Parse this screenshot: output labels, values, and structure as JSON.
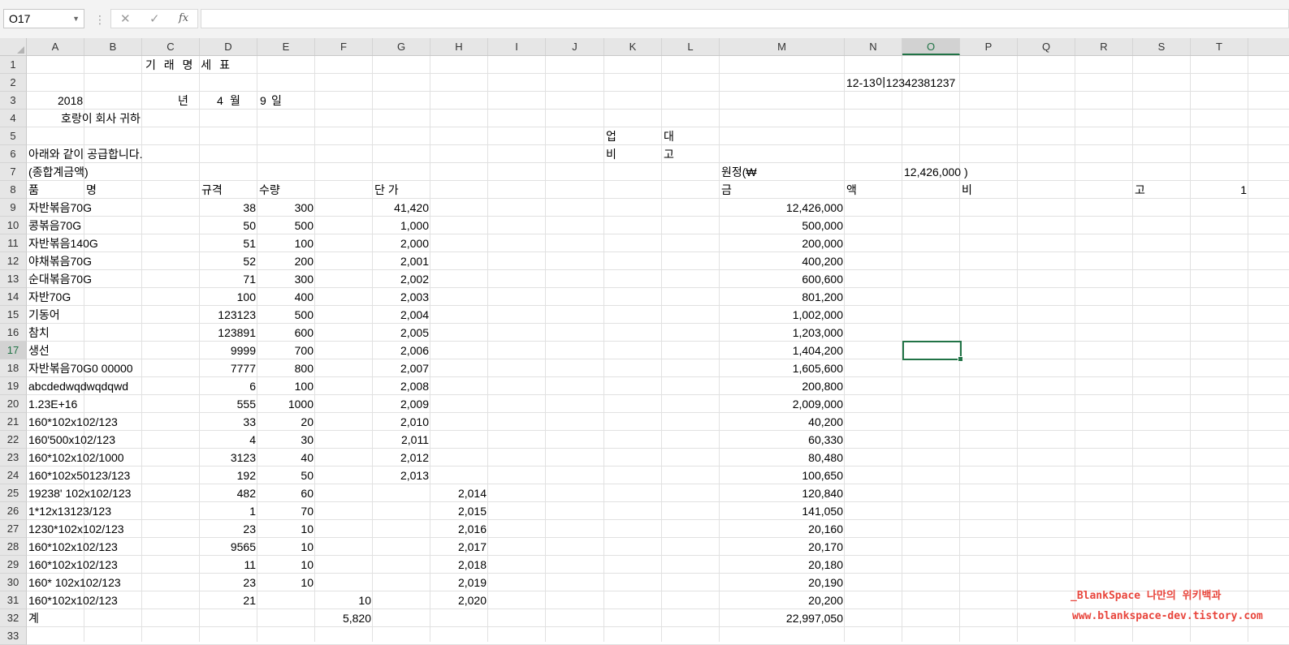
{
  "formula_bar": {
    "name_box": "O17",
    "cancel_icon": "✕",
    "enter_icon": "✓",
    "fx_label": "fx",
    "formula": ""
  },
  "columns": [
    "A",
    "B",
    "C",
    "D",
    "E",
    "F",
    "G",
    "H",
    "I",
    "J",
    "K",
    "L",
    "M",
    "N",
    "O",
    "P",
    "Q",
    "R",
    "S",
    "T"
  ],
  "rows": [
    "1",
    "2",
    "3",
    "4",
    "5",
    "6",
    "7",
    "8",
    "9",
    "10",
    "11",
    "12",
    "13",
    "14",
    "15",
    "16",
    "17",
    "18",
    "19",
    "20",
    "21",
    "22",
    "23",
    "24",
    "25",
    "26",
    "27",
    "28",
    "29",
    "30",
    "31",
    "32",
    "33"
  ],
  "selected": {
    "column": "O",
    "row": "17"
  },
  "sheet": {
    "title": "기 래 명 세 표",
    "ref": "12-13이12342381237",
    "year": "2018",
    "year_unit": "년",
    "month": "4",
    "month_unit": "월",
    "day": "9",
    "day_unit": "일",
    "recipient": "호랑이 회사  귀하",
    "k5": "업",
    "l5": "대",
    "k6": "비",
    "l6": "고",
    "supply_text": "아래와 같이 공급합니다.",
    "total_label": "(종합계금액)",
    "won_label": "원정(₩",
    "total_value": "12,426,000 )",
    "headers": {
      "a": "품",
      "b": "명",
      "d": "규격",
      "e": "수량",
      "g": "단 가",
      "m": "금",
      "n": "액",
      "p": "비",
      "s": "고",
      "t": "1"
    },
    "items": [
      {
        "name": "자반볶음70G",
        "spec": "38",
        "qty": "300",
        "price": "41,420",
        "amount": "12,426,000"
      },
      {
        "name": "콩볶음70G",
        "spec": "50",
        "qty": "500",
        "price": "1,000",
        "amount": "500,000"
      },
      {
        "name": "자반볶음140G",
        "spec": "51",
        "qty": "100",
        "price": "2,000",
        "amount": "200,000"
      },
      {
        "name": "야채볶음70G",
        "spec": "52",
        "qty": "200",
        "price": "2,001",
        "amount": "400,200"
      },
      {
        "name": "순대볶음70G",
        "spec": "71",
        "qty": "300",
        "price": "2,002",
        "amount": "600,600"
      },
      {
        "name": "자반70G",
        "spec": "100",
        "qty": "400",
        "price": "2,003",
        "amount": "801,200"
      },
      {
        "name": "기동어",
        "spec": "123123",
        "qty": "500",
        "price": "2,004",
        "amount": "1,002,000"
      },
      {
        "name": "참치",
        "spec": "123891",
        "qty": "600",
        "price": "2,005",
        "amount": "1,203,000"
      },
      {
        "name": "생선",
        "spec": "9999",
        "qty": "700",
        "price": "2,006",
        "amount": "1,404,200"
      },
      {
        "name": "자반볶음70G0 00000",
        "spec": "7777",
        "qty": "800",
        "price": "2,007",
        "amount": "1,605,600"
      },
      {
        "name": "abcdedwqdwqdqwd",
        "spec": "6",
        "qty": "100",
        "price": "2,008",
        "amount": "200,800"
      },
      {
        "name": " 1.23E+16",
        "spec": "555",
        "qty": "1000",
        "price": "2,009",
        "amount": "2,009,000"
      },
      {
        "name": "160*102x102/123",
        "spec": "33",
        "qty": "20",
        "price": "2,010",
        "amount": "40,200"
      },
      {
        "name": "160'500x102/123",
        "spec": "4",
        "qty": "30",
        "price": "2,011",
        "amount": "60,330"
      },
      {
        "name": "160*102x102/1000",
        "spec": "3123",
        "qty": "40",
        "price": "2,012",
        "amount": "80,480"
      },
      {
        "name": "160*102x50123/123",
        "spec": "192",
        "qty": "50",
        "price": "2,013",
        "amount": "100,650"
      },
      {
        "name": "19238' 102x102/123",
        "spec": "482",
        "qty": "60",
        "price_h": "2,014",
        "amount": "120,840"
      },
      {
        "name": "1*12x13123/123",
        "spec": "1",
        "qty": "70",
        "price_h": "2,015",
        "amount": "141,050"
      },
      {
        "name": "1230*102x102/123",
        "spec": "23",
        "qty": "10",
        "price_h": "2,016",
        "amount": "20,160"
      },
      {
        "name": "160*102x102/123",
        "spec": "9565",
        "qty": "10",
        "price_h": "2,017",
        "amount": "20,170"
      },
      {
        "name": "160*102x102/123",
        "spec": "11",
        "qty": "10",
        "price_h": "2,018",
        "amount": "20,180"
      },
      {
        "name": "160* 102x102/123",
        "spec": "23",
        "qty": "10",
        "price_h": "2,019",
        "amount": "20,190"
      },
      {
        "name": "160*102x102/123",
        "spec": "21",
        "f": "10",
        "price_h": "2,020",
        "amount": "20,200"
      }
    ],
    "sum_label": "계",
    "sum_f": "5,820",
    "sum_amount": "22,997,050"
  },
  "watermark": {
    "line1": "_BlankSpace 나만의 위키백과",
    "line2": "www.blankspace-dev.tistory.com"
  }
}
